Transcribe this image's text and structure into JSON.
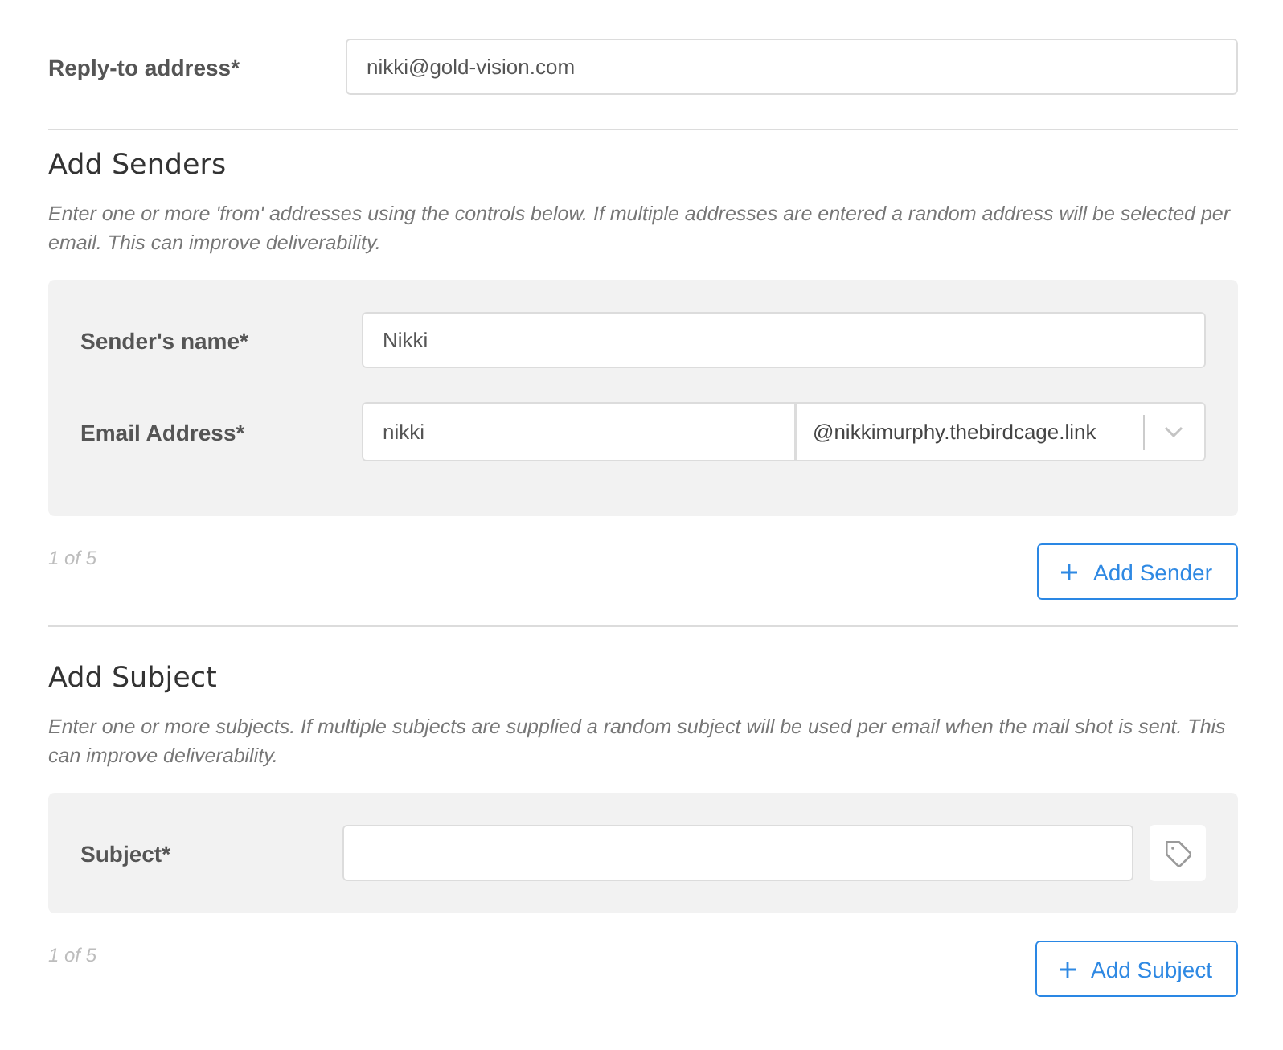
{
  "reply_to": {
    "label": "Reply-to address*",
    "value": "nikki@gold-vision.com"
  },
  "sections": [
    {
      "title": "Add Senders",
      "description": "Enter one or more 'from' addresses using the controls below. If multiple addresses are entered a random address will be selected per email. This can improve deliverability.",
      "fields": [
        {
          "kind": "text",
          "label": "Sender's name*",
          "value": "Nikki"
        },
        {
          "kind": "email",
          "label": "Email Address*",
          "value": "nikki",
          "domain": "@nikkimurphy.thebirdcage.link"
        }
      ],
      "count": "1 of 5",
      "button": "Add Sender"
    },
    {
      "title": "Add Subject",
      "description": "Enter one or more subjects. If multiple subjects are supplied a random subject will be used per email when the mail shot is sent. This can improve deliverability.",
      "fields": [
        {
          "kind": "tagged",
          "label": "Subject*"
        }
      ],
      "count": "1 of 5",
      "button": "Add Subject"
    }
  ]
}
